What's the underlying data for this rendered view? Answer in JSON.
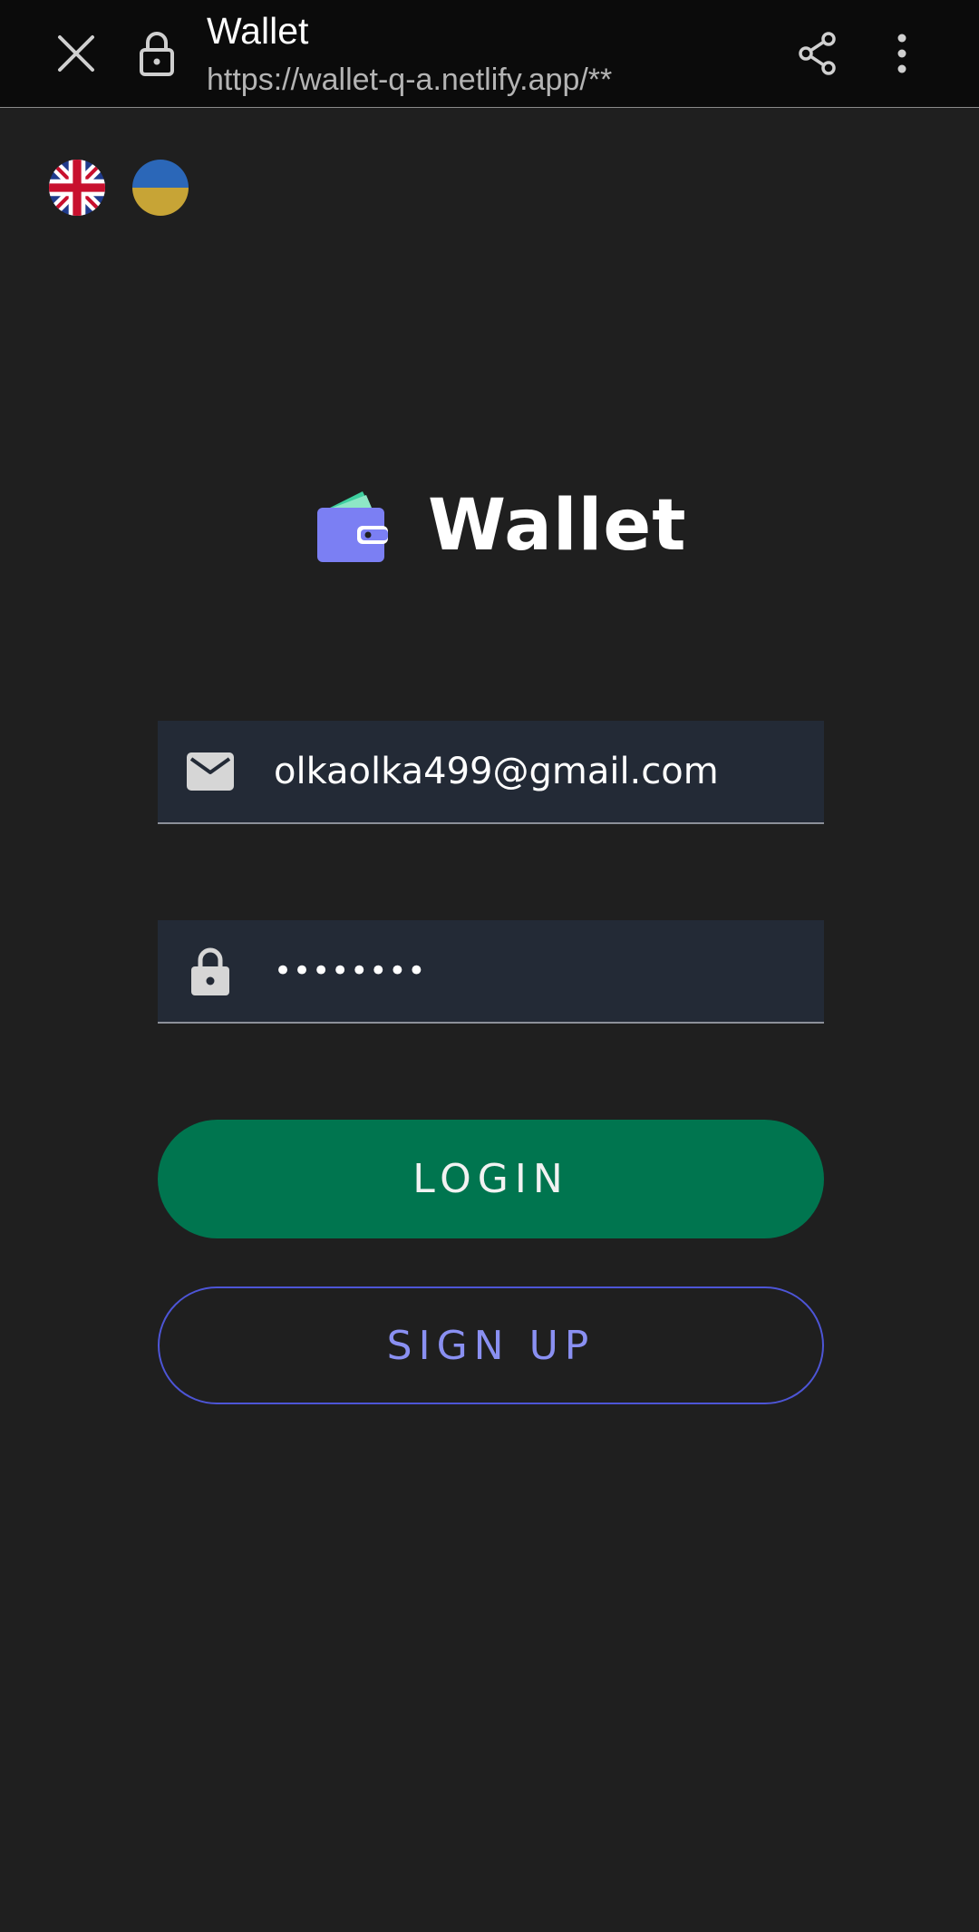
{
  "browser": {
    "title": "Wallet",
    "url": "https://wallet-q-a.netlify.app/**"
  },
  "languages": [
    {
      "name": "English",
      "icon": "uk-flag-icon"
    },
    {
      "name": "Ukrainian",
      "icon": "ukraine-flag-icon"
    }
  ],
  "logo": {
    "text": "Wallet"
  },
  "form": {
    "email_value": "olkaolka499@gmail.com",
    "password_value": "••••••••",
    "login_label": "LOGIN",
    "signup_label": "SIGN UP"
  },
  "colors": {
    "background": "#1f1f1f",
    "field_bg": "#232a36",
    "login_green": "#00754f",
    "signup_border": "#4d55d6",
    "signup_text": "#8a90f2",
    "wallet_purple": "#7b7ff3",
    "wallet_teal": "#3ecf9f"
  }
}
